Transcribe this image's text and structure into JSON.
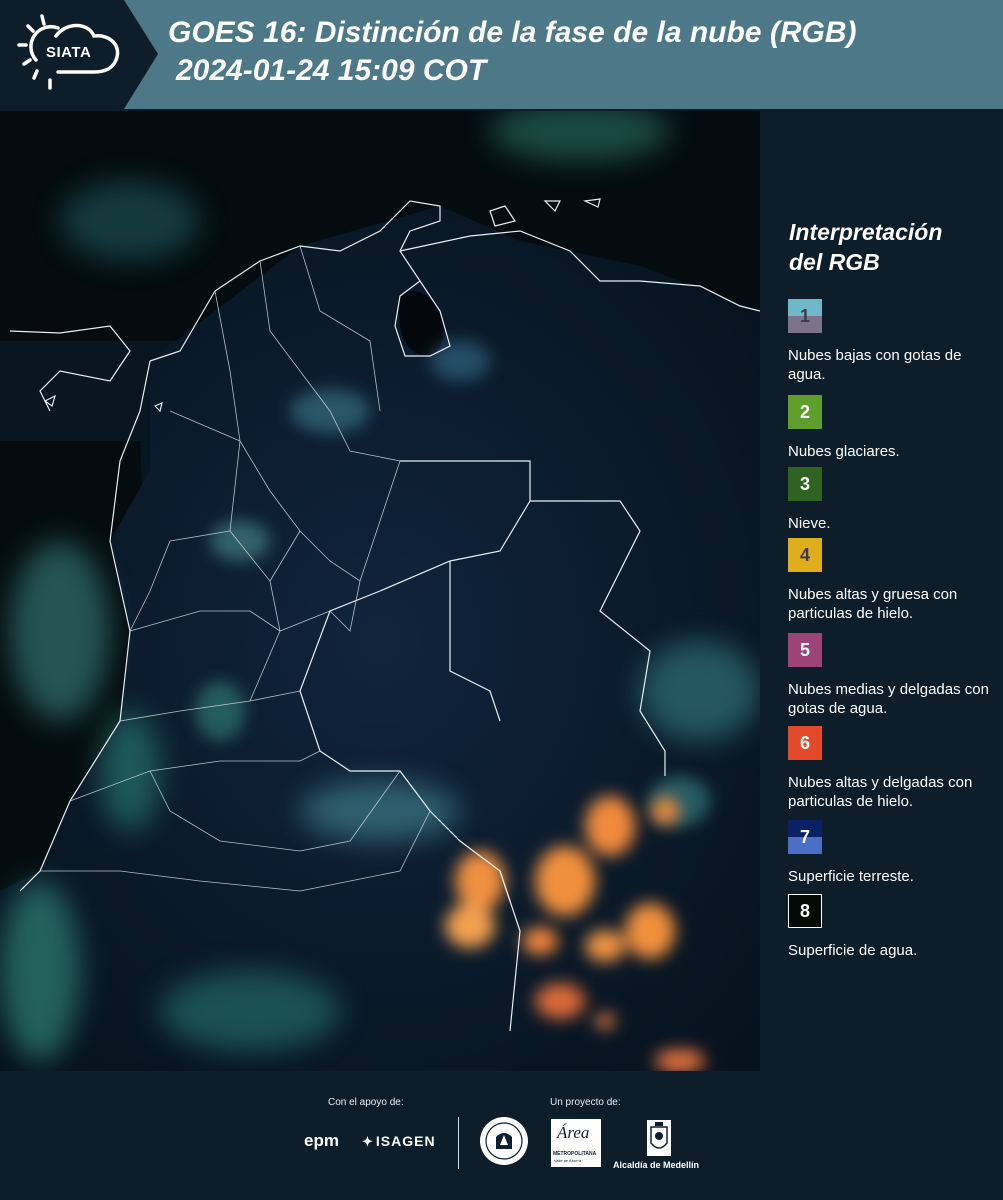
{
  "header": {
    "logo_text": "SIATA",
    "title_line1": "GOES 16: Distinción de la fase de la nube (RGB)",
    "title_line2": "2024-01-24 15:09 COT"
  },
  "legend": {
    "title_line1": "Interpretación",
    "title_line2": "del RGB",
    "items": [
      {
        "num": "1",
        "label": "Nubes bajas con gotas de agua.",
        "color": "#6fb8c8",
        "color_bottom": "#7b7389",
        "num_color": "#3a3a4a"
      },
      {
        "num": "2",
        "label": "Nubes glaciares.",
        "color": "#5e9e2d",
        "num_color": "#ffffff"
      },
      {
        "num": "3",
        "label": "Nieve.",
        "color": "#2e6320",
        "num_color": "#ffffff"
      },
      {
        "num": "4",
        "label": "Nubes altas y gruesa con particulas de hielo.",
        "color": "#e0ad1d",
        "num_color": "#3a3a4a"
      },
      {
        "num": "5",
        "label": "Nubes medias y delgadas con gotas de agua.",
        "color": "#9c4477",
        "num_color": "#ffffff"
      },
      {
        "num": "6",
        "label": "Nubes altas y delgadas con particulas de hielo.",
        "color": "#e24a2a",
        "num_color": "#ffffff"
      },
      {
        "num": "7",
        "label": "Superficie terreste.",
        "color": "#0c2066",
        "color_bottom": "#4a6fc4",
        "num_color": "#ffffff"
      },
      {
        "num": "8",
        "label": "Superficie de agua.",
        "color": "#040b06",
        "num_color": "#ffffff"
      }
    ]
  },
  "footer": {
    "support_label": "Con el apoyo de:",
    "project_label": "Un proyecto de:",
    "epm": "epm",
    "isagen": "ISAGEN",
    "area_line1": "Área",
    "area_line2": "METROPOLITANA",
    "area_line3": "Valle de Aburrá",
    "medellin": "Alcaldía de Medellín"
  }
}
